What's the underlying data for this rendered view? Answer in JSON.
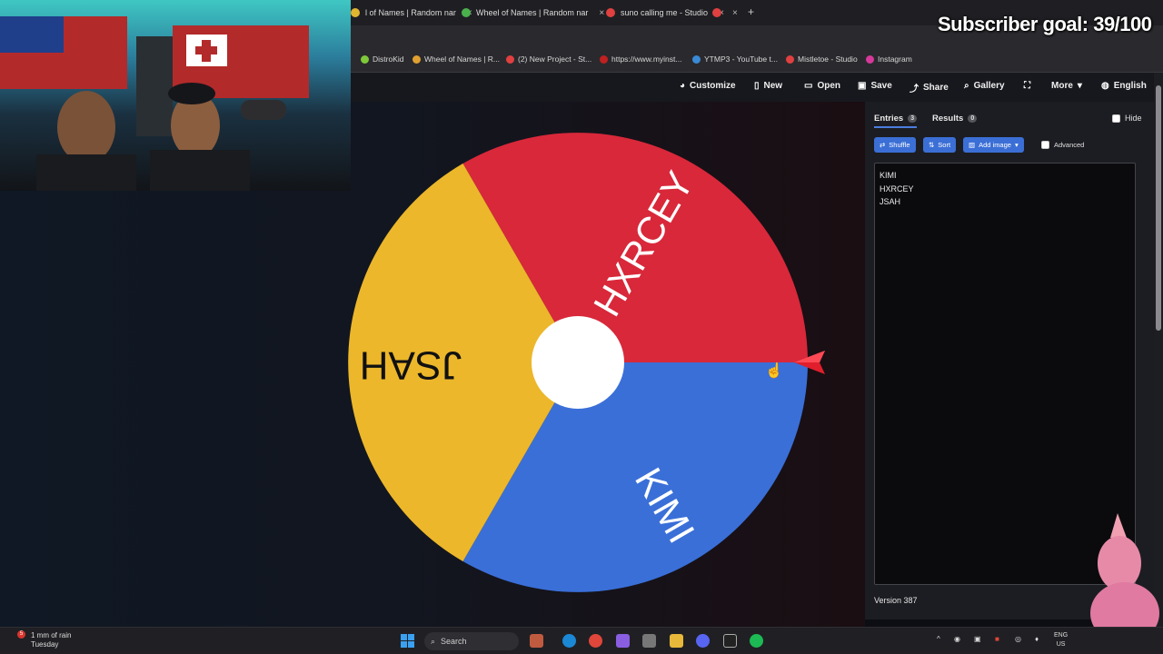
{
  "browser": {
    "tabs": [
      {
        "label": "l of Names | Random nar",
        "close": "×",
        "color": "#e0b530"
      },
      {
        "label": "Wheel of Names | Random nar",
        "close": "×",
        "color": "#4ab04c"
      },
      {
        "label": "suno calling me - Studio",
        "close": "×",
        "color": "#e04040"
      },
      {
        "label": "",
        "close": "×",
        "color": "#e04040"
      }
    ],
    "new_tab": "+"
  },
  "bookmarks": [
    {
      "label": "DistroKid",
      "color": "#7ec83a"
    },
    {
      "label": "Wheel of Names | R...",
      "color": "#e0a030"
    },
    {
      "label": "(2) New Project - St...",
      "color": "#e04040"
    },
    {
      "label": "https://www.myinst...",
      "color": "#c02020"
    },
    {
      "label": "YTMP3 - YouTube t...",
      "color": "#3a8ad6"
    },
    {
      "label": "Mistletoe - Studio",
      "color": "#e04040"
    },
    {
      "label": "Instagram",
      "color": "#d6399a"
    }
  ],
  "toolbar": {
    "customize": "Customize",
    "new": "New",
    "open": "Open",
    "save": "Save",
    "share": "Share",
    "gallery": "Gallery",
    "more": "More",
    "language": "English"
  },
  "wheel": {
    "segments": [
      {
        "label": "HXRCEY",
        "color": "#d8283a"
      },
      {
        "label": "KIMI",
        "color": "#3a6fd8"
      },
      {
        "label": "JSAH",
        "color": "#ecb72a"
      }
    ]
  },
  "panel": {
    "tabs": {
      "entries": {
        "label": "Entries",
        "count": "3"
      },
      "results": {
        "label": "Results",
        "count": "0"
      }
    },
    "hide": "Hide",
    "buttons": {
      "shuffle": "Shuffle",
      "sort": "Sort",
      "add_image": "Add image"
    },
    "advanced": "Advanced",
    "entries": [
      "KIMI",
      "HXRCEY",
      "JSAH"
    ],
    "version": "Version 387"
  },
  "overlay": {
    "subscriber_goal": "Subscriber goal: 39/100"
  },
  "taskbar": {
    "weather_line1": "1 mm of rain",
    "weather_line2": "Tuesday",
    "weather_badge": "5",
    "search": "Search",
    "lang_line1": "ENG",
    "lang_line2": "US"
  }
}
